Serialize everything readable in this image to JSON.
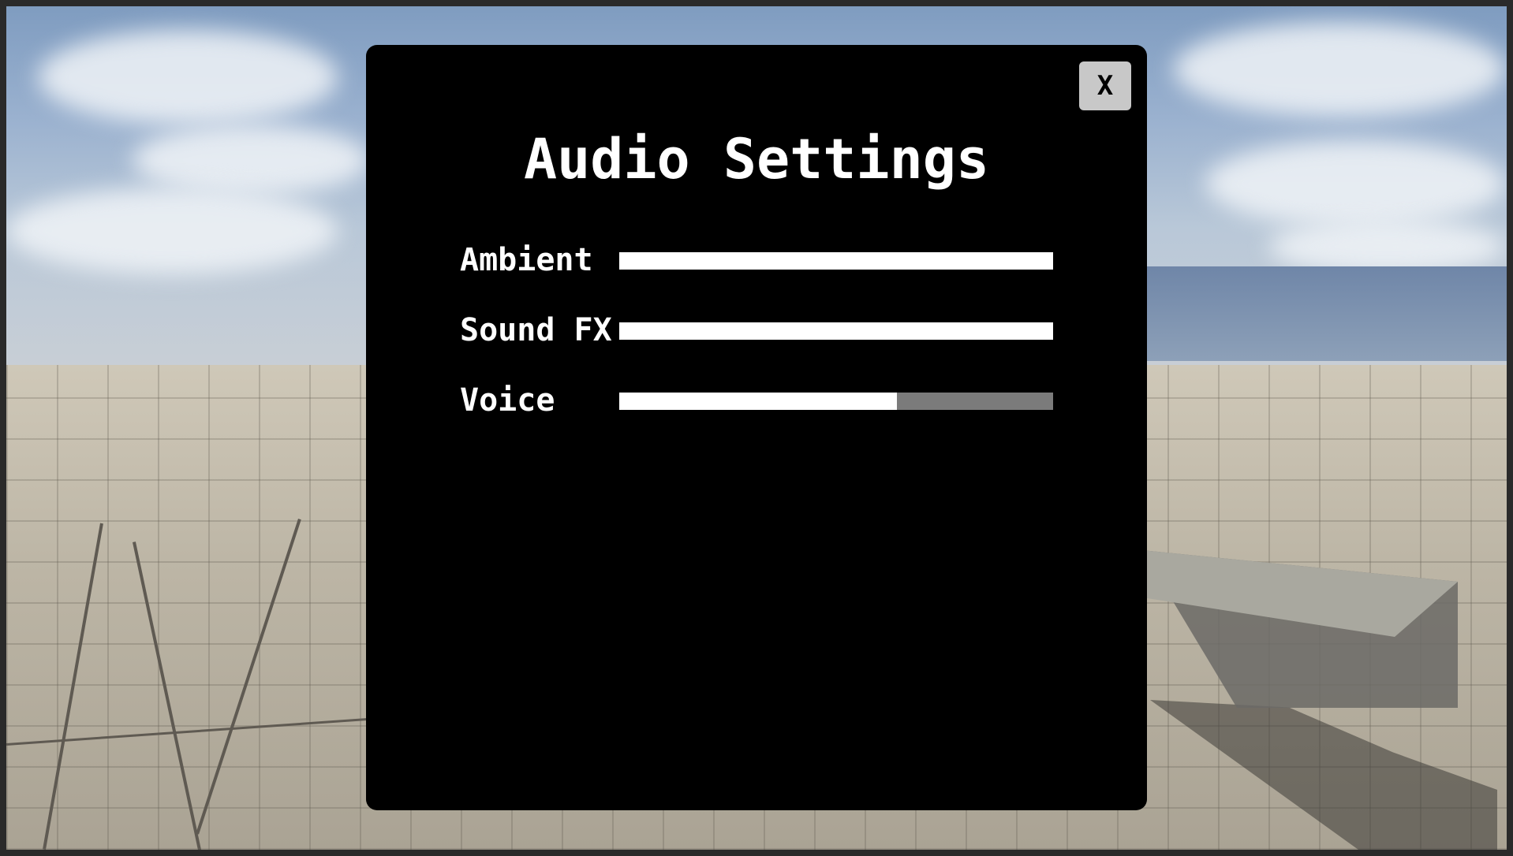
{
  "dialog": {
    "title": "Audio Settings",
    "close_label": "X"
  },
  "sliders": [
    {
      "label": "Ambient",
      "value": 1.0
    },
    {
      "label": "Sound FX",
      "value": 1.0
    },
    {
      "label": "Voice",
      "value": 0.64
    }
  ],
  "colors": {
    "panel_bg": "#000000",
    "text": "#ffffff",
    "slider_fill": "#ffffff",
    "slider_track": "#7b7b7b",
    "close_button_bg": "#c8c8c8"
  }
}
